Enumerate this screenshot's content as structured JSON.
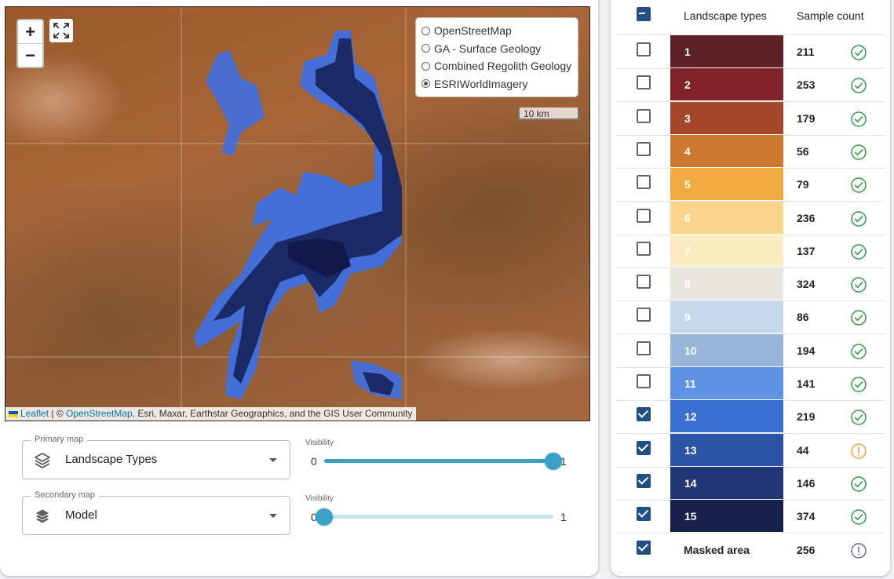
{
  "map": {
    "zoom_in": "+",
    "zoom_out": "−",
    "scale": "10 km",
    "base_layers": [
      {
        "label": "OpenStreetMap",
        "selected": false
      },
      {
        "label": "GA - Surface Geology",
        "selected": false
      },
      {
        "label": "Combined Regolith Geology",
        "selected": false
      },
      {
        "label": "ESRIWorldImagery",
        "selected": true
      }
    ],
    "attribution": {
      "leaflet": "Leaflet",
      "sep": " | © ",
      "osm": "OpenStreetMap",
      "rest": ", Esri, Maxar, Earthstar Geographics, and the GIS User Community"
    }
  },
  "controls": {
    "primary": {
      "legend": "Primary map",
      "value": "Landscape Types",
      "visibility_label": "Visibility",
      "min": "0",
      "max": "1",
      "visibility": 1.0
    },
    "secondary": {
      "legend": "Secondary map",
      "value": "Model",
      "visibility_label": "Visibility",
      "min": "0",
      "max": "1",
      "visibility": 0.0
    }
  },
  "table": {
    "col_types": "Landscape types",
    "col_count": "Sample count",
    "rows": [
      {
        "label": "1",
        "count": "211",
        "color": "#5e2127",
        "text": "#ffffff",
        "checked": false,
        "status": "ok"
      },
      {
        "label": "2",
        "count": "253",
        "color": "#7f2329",
        "text": "#ffffff",
        "checked": false,
        "status": "ok"
      },
      {
        "label": "3",
        "count": "179",
        "color": "#a4472a",
        "text": "#ffffff",
        "checked": false,
        "status": "ok"
      },
      {
        "label": "4",
        "count": "56",
        "color": "#cc7a30",
        "text": "#ffffff",
        "checked": false,
        "status": "ok"
      },
      {
        "label": "5",
        "count": "79",
        "color": "#efab40",
        "text": "#ffffff",
        "checked": false,
        "status": "ok"
      },
      {
        "label": "6",
        "count": "236",
        "color": "#fbd68a",
        "text": "#ffffff",
        "checked": false,
        "status": "ok"
      },
      {
        "label": "7",
        "count": "137",
        "color": "#fcecc2",
        "text": "#ffffff",
        "checked": false,
        "status": "ok"
      },
      {
        "label": "8",
        "count": "324",
        "color": "#e7e6df",
        "text": "#ffffff",
        "checked": false,
        "status": "ok"
      },
      {
        "label": "9",
        "count": "86",
        "color": "#c8d8eb",
        "text": "#ffffff",
        "checked": false,
        "status": "ok"
      },
      {
        "label": "10",
        "count": "194",
        "color": "#97b5d8",
        "text": "#ffffff",
        "checked": false,
        "status": "ok"
      },
      {
        "label": "11",
        "count": "141",
        "color": "#5f93e6",
        "text": "#ffffff",
        "checked": false,
        "status": "ok"
      },
      {
        "label": "12",
        "count": "219",
        "color": "#3a6fd2",
        "text": "#ffffff",
        "checked": true,
        "status": "ok"
      },
      {
        "label": "13",
        "count": "44",
        "color": "#2b53a6",
        "text": "#ffffff",
        "checked": true,
        "status": "warn"
      },
      {
        "label": "14",
        "count": "146",
        "color": "#213675",
        "text": "#ffffff",
        "checked": true,
        "status": "ok"
      },
      {
        "label": "15",
        "count": "374",
        "color": "#16204a",
        "text": "#ffffff",
        "checked": true,
        "status": "ok"
      }
    ],
    "masked": {
      "label": "Masked area",
      "count": "256",
      "checked": true,
      "status": "info"
    }
  }
}
